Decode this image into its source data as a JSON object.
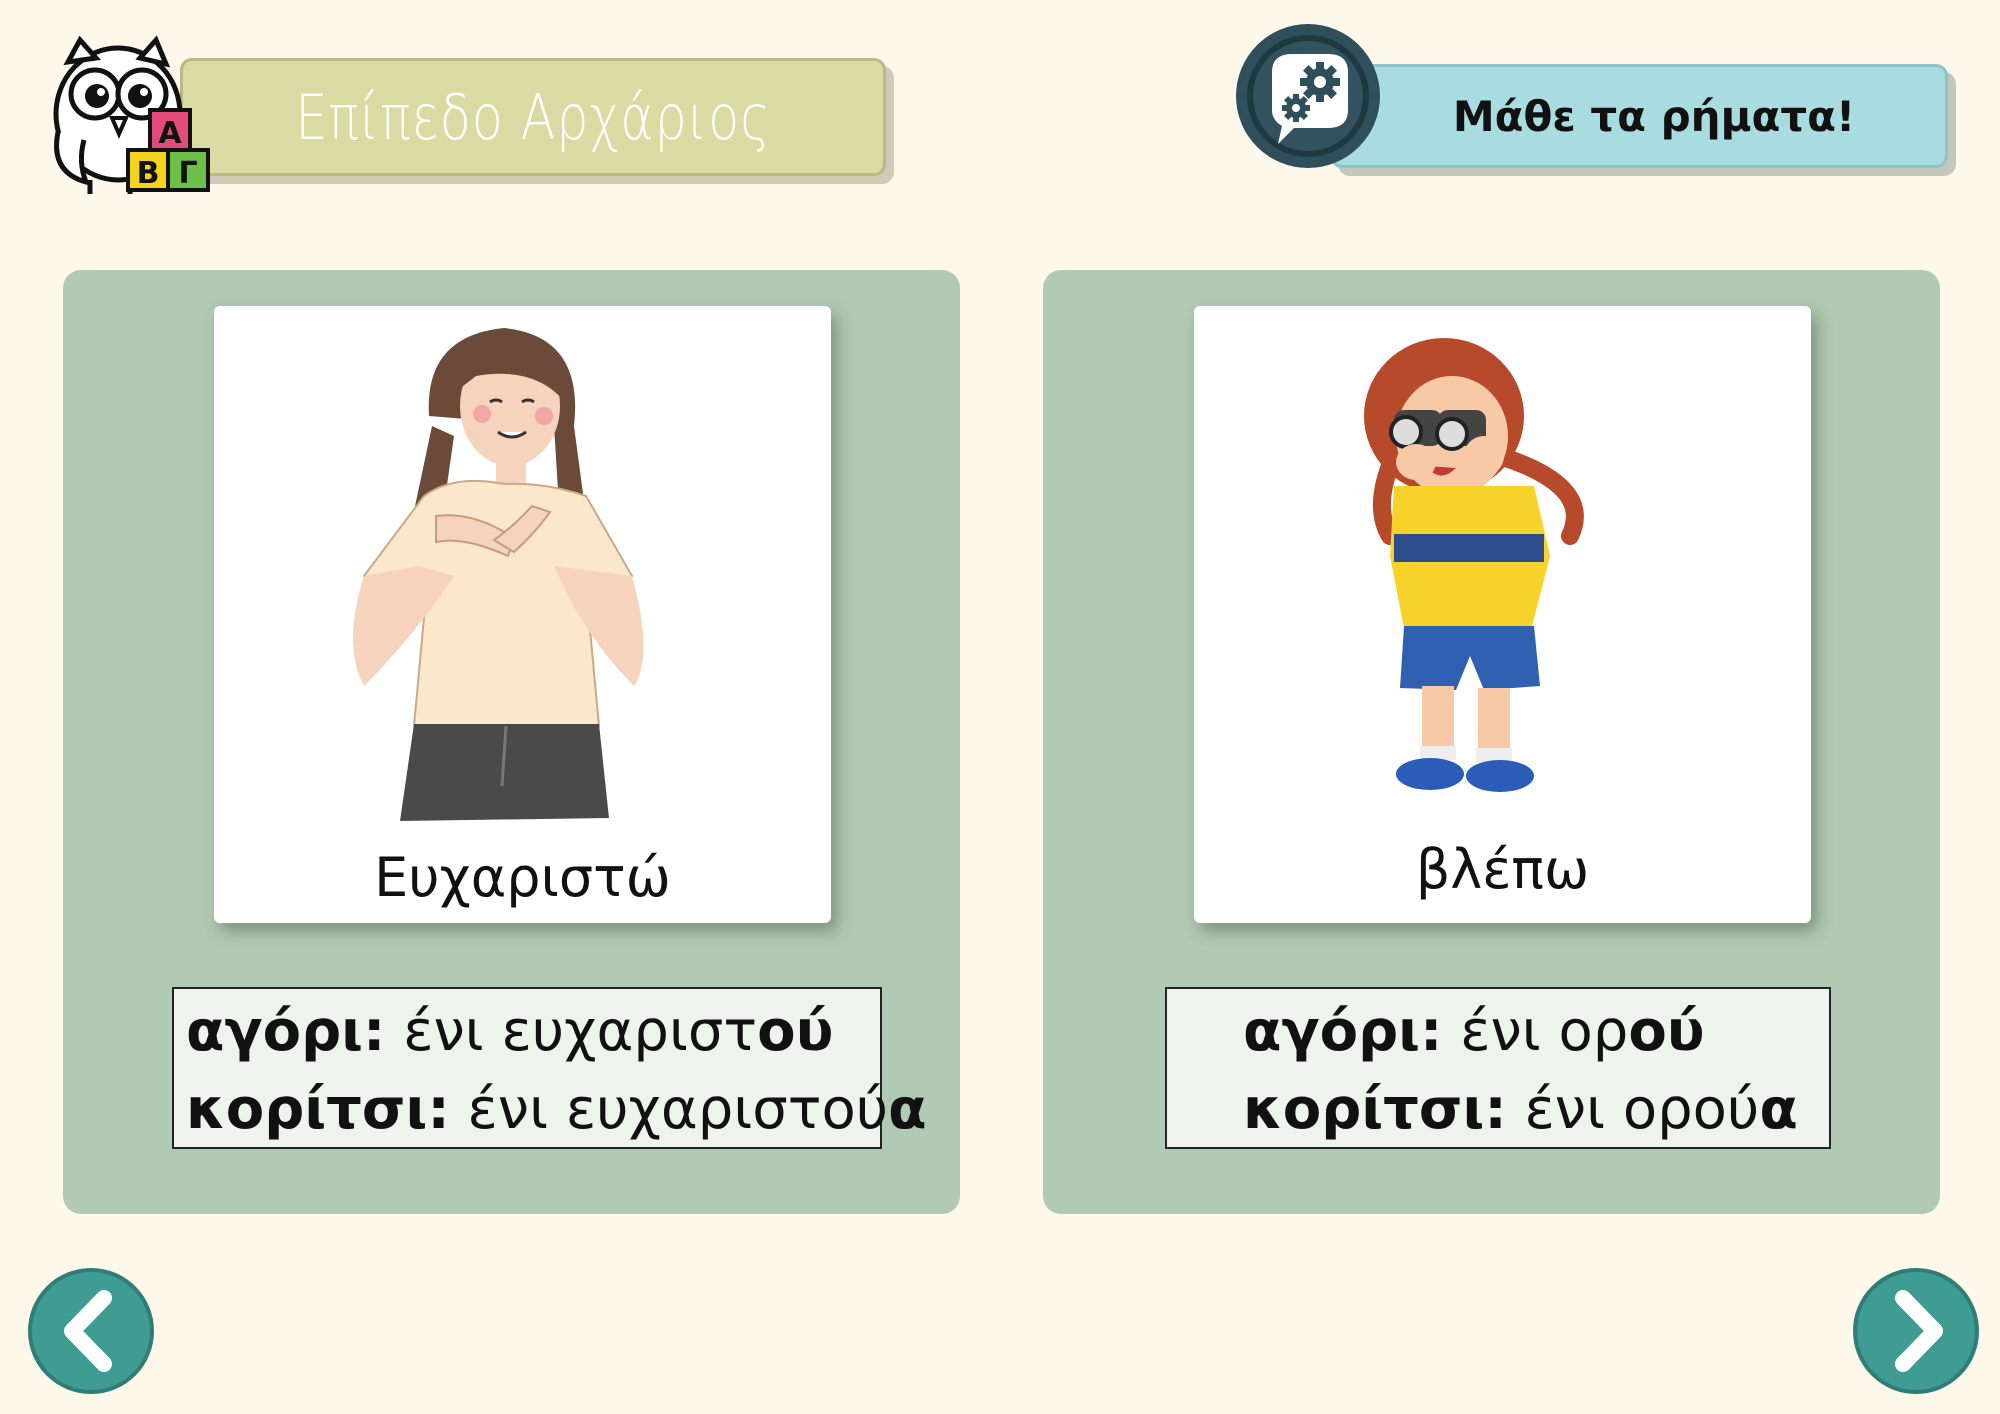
{
  "header": {
    "level_title": "Επίπεδο Αρχάριος",
    "learn_title": "Μάθε τα ρήματα!",
    "logo_letters": [
      "Α",
      "Β",
      "Γ"
    ]
  },
  "cards": [
    {
      "word": "Ευχαριστώ",
      "illustration": "woman-hands-on-chest",
      "boy_label": "αγόρι:",
      "boy_stem": " ένι ευχαριστ",
      "boy_ending": "ού",
      "girl_label": "κορίτσι:",
      "girl_stem": " ένι ευχαριστού",
      "girl_ending": "α"
    },
    {
      "word": "βλέπω",
      "illustration": "girl-with-binoculars",
      "boy_label": "αγόρι:",
      "boy_stem": " ένι ορ",
      "boy_ending": "ού",
      "girl_label": "κορίτσι:",
      "girl_stem": " ένι ορού",
      "girl_ending": "α"
    }
  ],
  "nav": {
    "prev_icon": "chevron-left-icon",
    "next_icon": "chevron-right-icon"
  },
  "colors": {
    "background": "#fdf8e9",
    "level_banner": "#d9dba3",
    "learn_banner": "#a8dce0",
    "panel": "#b1cab3",
    "nav_button": "#3f9c93"
  }
}
